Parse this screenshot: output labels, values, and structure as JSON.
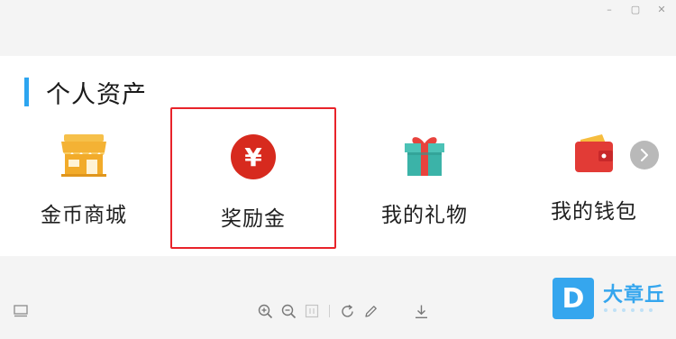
{
  "window": {
    "controls": [
      "–",
      "▢",
      "✕"
    ]
  },
  "section": {
    "title": "个人资产"
  },
  "items": [
    {
      "label": "金币商城",
      "icon": "store-icon"
    },
    {
      "label": "奖励金",
      "icon": "yuan-coin-icon"
    },
    {
      "label": "我的礼物",
      "icon": "gift-icon"
    },
    {
      "label": "我的钱包",
      "icon": "wallet-icon"
    }
  ],
  "highlight": {
    "target": "奖励金",
    "color": "#e8232a"
  },
  "colors": {
    "accent": "#2da5f0",
    "coin": "#d72a1e",
    "store": "#f4b234",
    "gift": "#3bb3a8",
    "wallet": "#e23b36"
  },
  "toolbar": {
    "icons": [
      "zoom-in-icon",
      "zoom-out-icon",
      "fit-icon",
      "rotate-icon",
      "edit-icon",
      "download-icon"
    ]
  },
  "watermark": {
    "logo_letter": "D",
    "text": "大章丘"
  }
}
